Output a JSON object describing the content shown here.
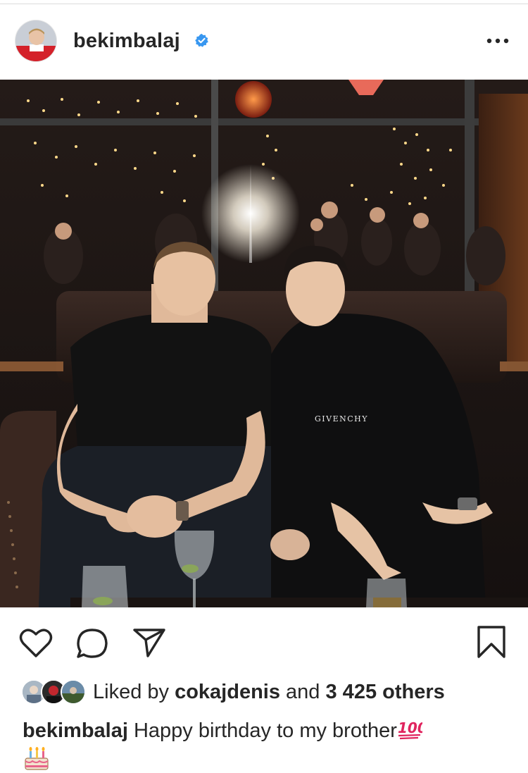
{
  "post": {
    "username": "bekimbalaj",
    "verified": true
  },
  "icons": {
    "verified": "verified-badge-icon",
    "more": "more-options-icon",
    "like": "heart-icon",
    "comment": "comment-bubble-icon",
    "share": "paper-plane-icon",
    "save": "bookmark-icon",
    "hundred": "hundred-points-emoji",
    "cake": "birthday-cake-emoji"
  },
  "likes": {
    "prefix": "Liked by",
    "user": "cokajdenis",
    "joiner": "and",
    "others": "3 425 others"
  },
  "caption": {
    "username": "bekimbalaj",
    "text": "Happy birthday to my brother"
  },
  "colors": {
    "verified_blue": "#3897f0",
    "text": "#262626",
    "emoji_red": "#e0245e"
  }
}
